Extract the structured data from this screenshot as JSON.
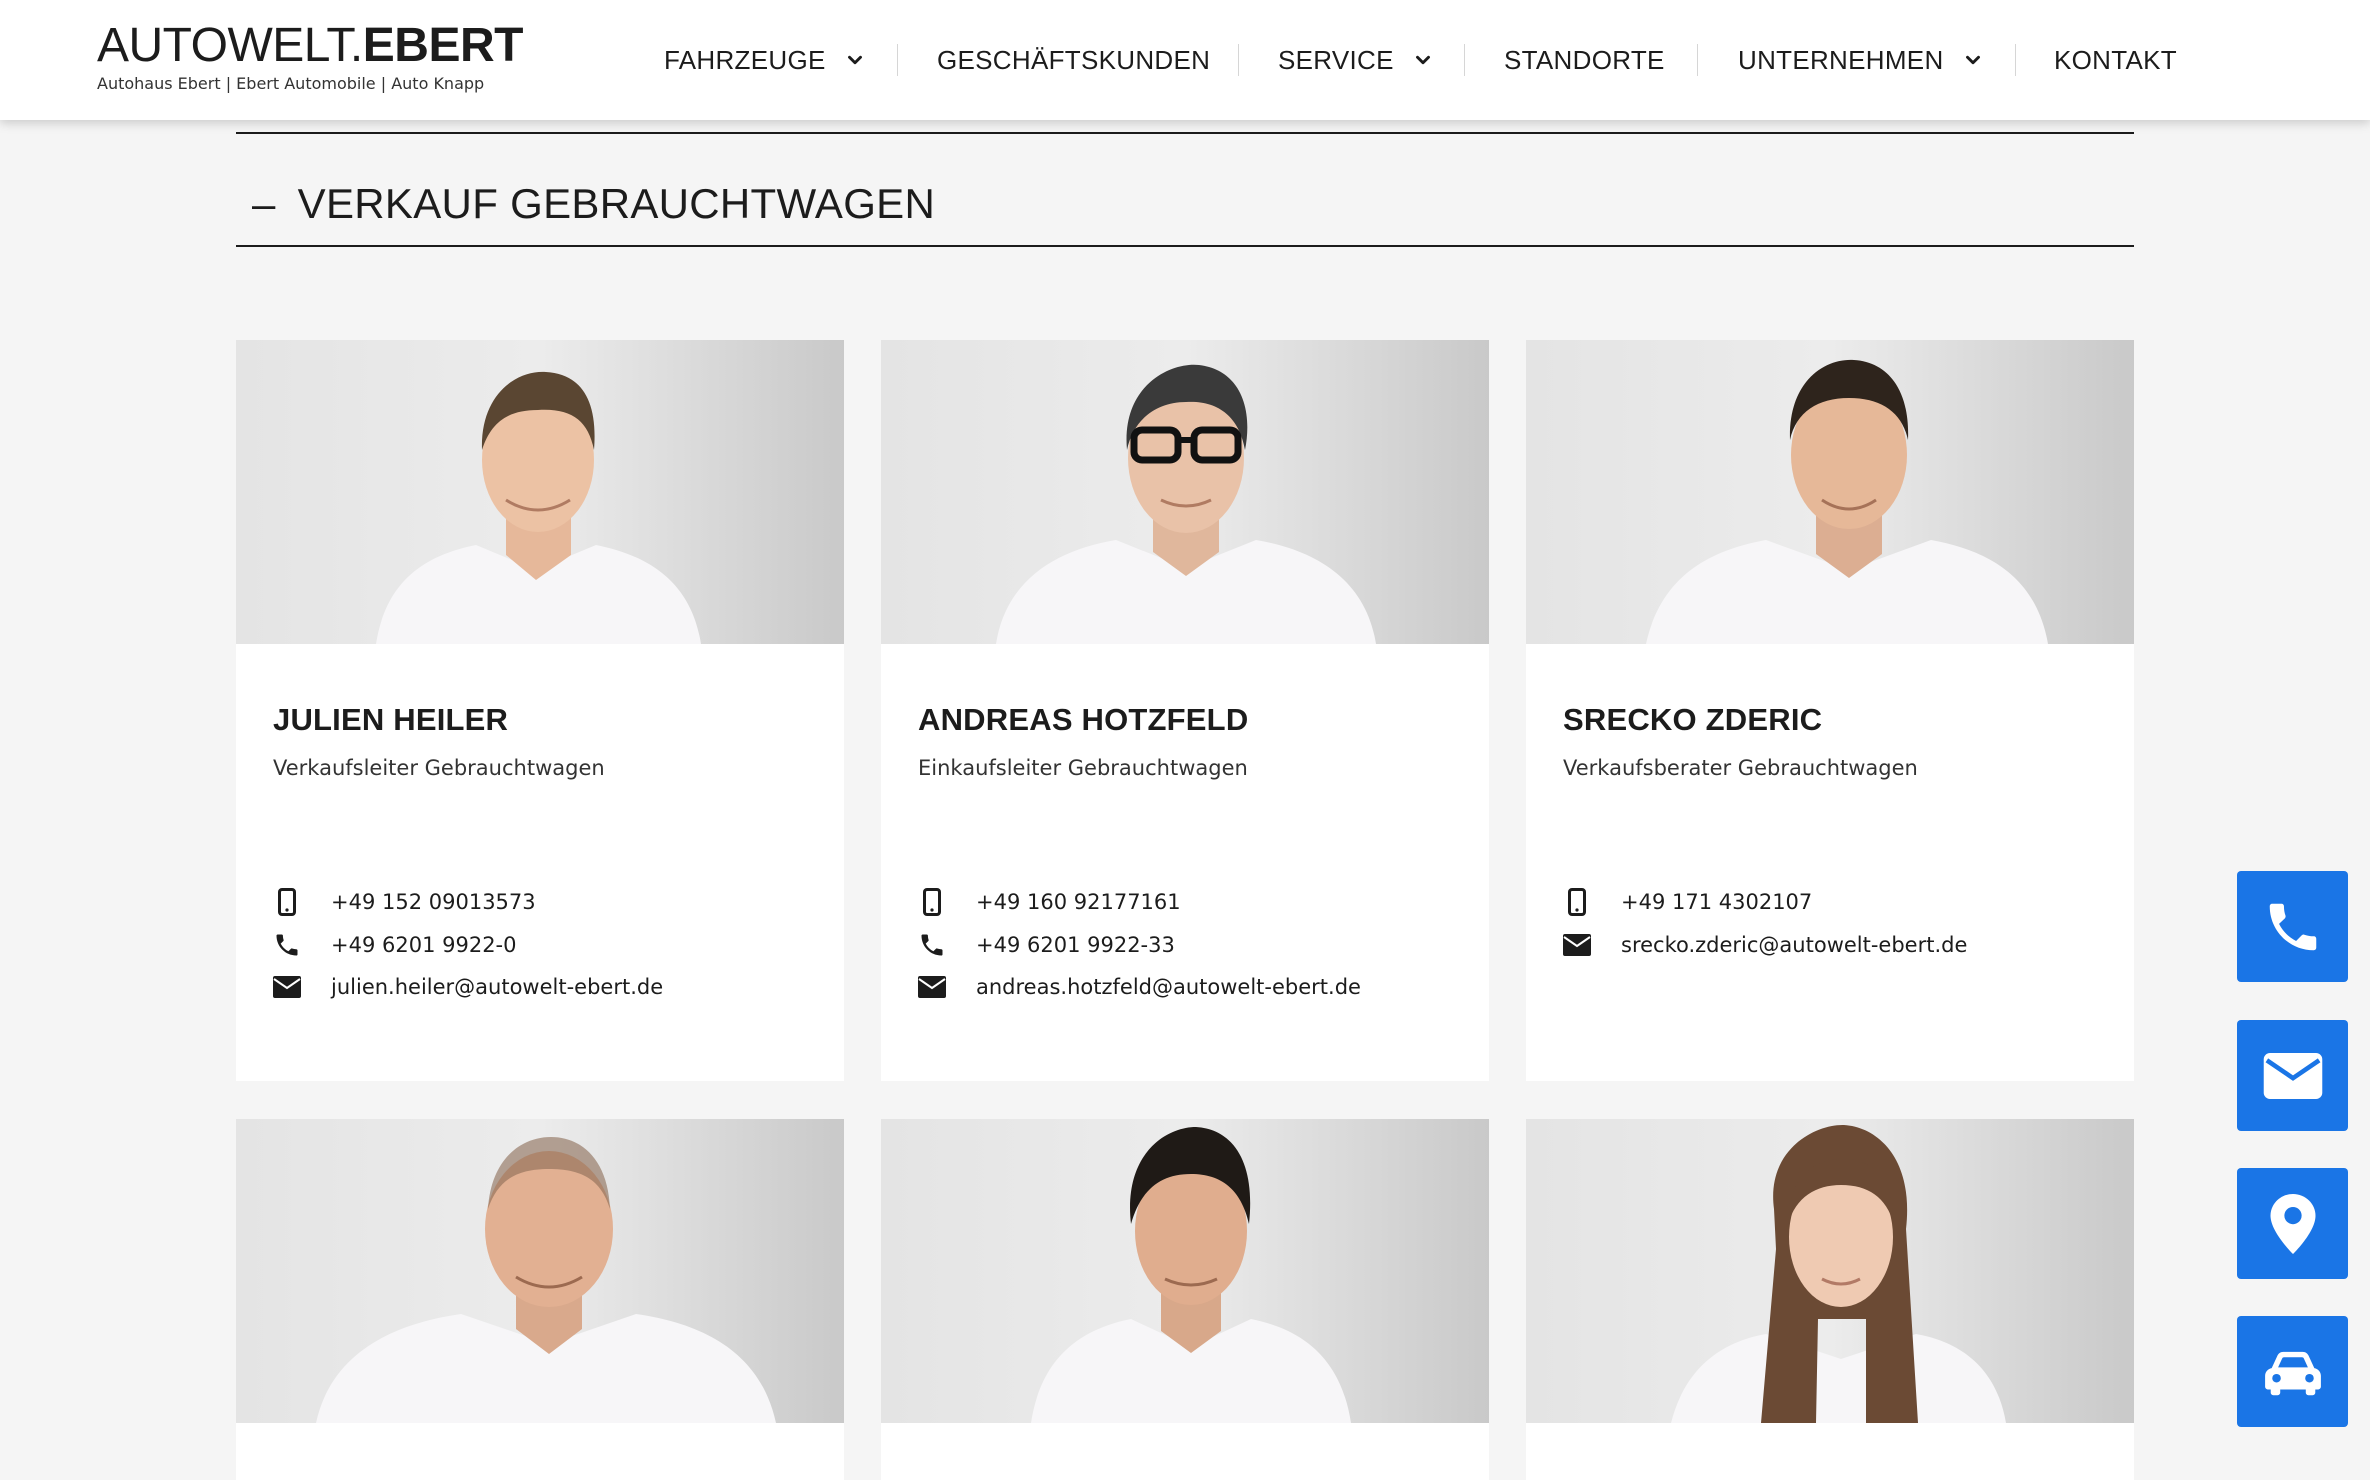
{
  "header": {
    "logo_light": "AUTOWELT.",
    "logo_bold": "EBERT",
    "logo_sub": "Autohaus Ebert | Ebert Automobile | Auto Knapp"
  },
  "nav": {
    "items": [
      {
        "label": "FAHRZEUGE",
        "dropdown": true
      },
      {
        "label": "GESCHÄFTSKUNDEN",
        "dropdown": false
      },
      {
        "label": "SERVICE",
        "dropdown": true
      },
      {
        "label": "STANDORTE",
        "dropdown": false
      },
      {
        "label": "UNTERNEHMEN",
        "dropdown": true
      },
      {
        "label": "KONTAKT",
        "dropdown": false
      }
    ]
  },
  "section": {
    "dash": "–",
    "title": "VERKAUF GEBRAUCHTWAGEN"
  },
  "team": [
    {
      "name": "JULIEN HEILER",
      "role": "Verkaufsleiter Gebrauchtwagen",
      "mobile": "+49 152 09013573",
      "phone": "+49 6201 9922-0",
      "email": "julien.heiler@autowelt-ebert.de"
    },
    {
      "name": "ANDREAS HOTZFELD",
      "role": "Einkaufsleiter Gebrauchtwagen",
      "mobile": "+49 160 92177161",
      "phone": "+49 6201 9922-33",
      "email": "andreas.hotzfeld@autowelt-ebert.de"
    },
    {
      "name": "SRECKO ZDERIC",
      "role": "Verkaufsberater Gebrauchtwagen",
      "mobile": "+49 171 4302107",
      "email": "srecko.zderic@autowelt-ebert.de"
    }
  ],
  "floating_buttons": [
    {
      "icon": "phone-icon"
    },
    {
      "icon": "envelope-icon"
    },
    {
      "icon": "map-pin-icon"
    },
    {
      "icon": "car-icon"
    }
  ],
  "colors": {
    "accent": "#1a75e6",
    "text": "#1c1c1c",
    "page_bg": "#f5f5f5"
  }
}
